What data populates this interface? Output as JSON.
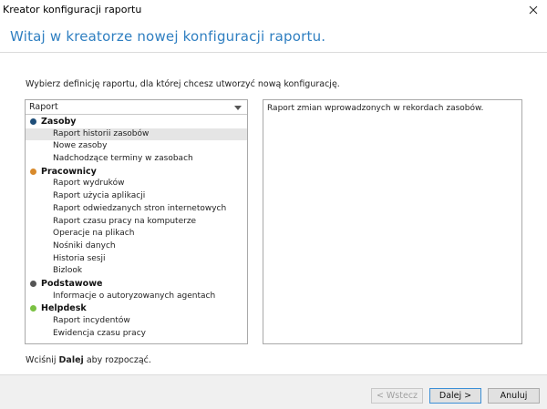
{
  "window": {
    "title": "Kreator konfiguracji raportu"
  },
  "header": {
    "heading": "Witaj w kreatorze nowej konfiguracji raportu."
  },
  "main": {
    "instruction": "Wybierz definicję raportu, dla której chcesz utworzyć nową konfigurację.",
    "dropdown_value": "Raport",
    "groups": [
      {
        "label": "Zasoby",
        "color": "#1f4e79",
        "items": [
          "Raport historii zasobów",
          "Nowe zasoby",
          "Nadchodzące terminy w zasobach"
        ]
      },
      {
        "label": "Pracownicy",
        "color": "#d88a2c",
        "items": [
          "Raport wydruków",
          "Raport użycia aplikacji",
          "Raport odwiedzanych stron internetowych",
          "Raport czasu pracy na komputerze",
          "Operacje na plikach",
          "Nośniki danych",
          "Historia sesji",
          "Bizlook"
        ]
      },
      {
        "label": "Podstawowe",
        "color": "#555555",
        "items": [
          "Informacje o autoryzowanych agentach"
        ]
      },
      {
        "label": "Helpdesk",
        "color": "#7ac142",
        "items": [
          "Raport incydentów",
          "Ewidencja czasu pracy"
        ]
      }
    ],
    "selected_item": "Raport historii zasobów",
    "description": "Raport zmian wprowadzonych w rekordach zasobów.",
    "hint_prefix": "Wciśnij ",
    "hint_bold": "Dalej",
    "hint_suffix": " aby rozpocząć."
  },
  "footer": {
    "back_label": "< Wstecz",
    "next_label": "Dalej >",
    "cancel_label": "Anuluj"
  }
}
